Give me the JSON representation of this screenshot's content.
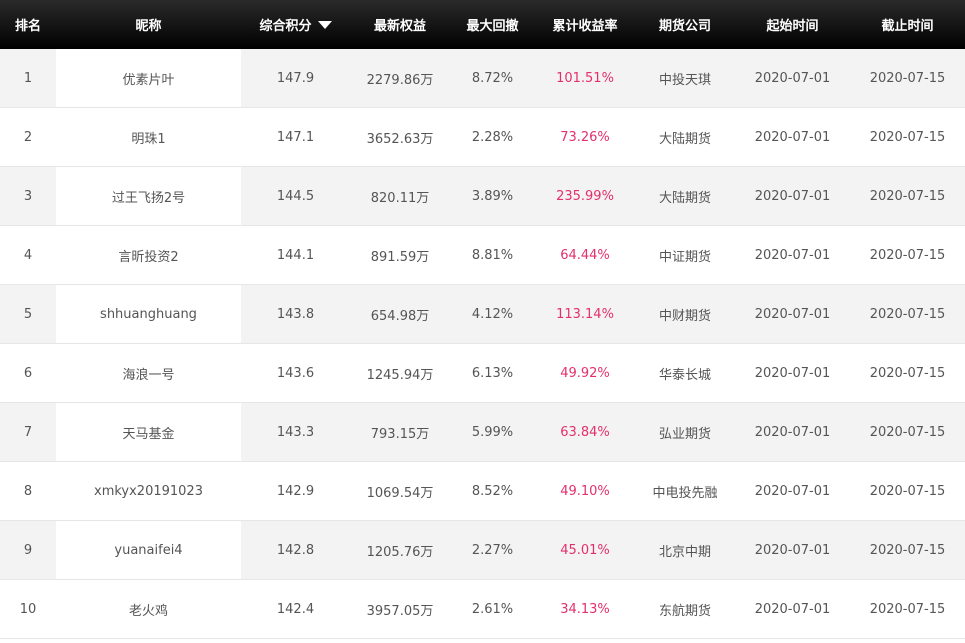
{
  "table": {
    "headers": {
      "rank": "排名",
      "nickname": "昵称",
      "score": "综合积分",
      "equity": "最新权益",
      "drawdown": "最大回撤",
      "return_rate": "累计收益率",
      "company": "期货公司",
      "start": "起始时间",
      "end": "截止时间"
    },
    "sort_icon": "sort-desc-triangle-icon",
    "accent_color": "#e3306c",
    "rows": [
      {
        "rank": "1",
        "nickname": "优素片叶",
        "score": "147.9",
        "equity": "2279.86万",
        "drawdown": "8.72%",
        "return_rate": "101.51%",
        "company": "中投天琪",
        "start": "2020-07-01",
        "end": "2020-07-15"
      },
      {
        "rank": "2",
        "nickname": "明珠1",
        "score": "147.1",
        "equity": "3652.63万",
        "drawdown": "2.28%",
        "return_rate": "73.26%",
        "company": "大陆期货",
        "start": "2020-07-01",
        "end": "2020-07-15"
      },
      {
        "rank": "3",
        "nickname": "过王飞扬2号",
        "score": "144.5",
        "equity": "820.11万",
        "drawdown": "3.89%",
        "return_rate": "235.99%",
        "company": "大陆期货",
        "start": "2020-07-01",
        "end": "2020-07-15"
      },
      {
        "rank": "4",
        "nickname": "言昕投资2",
        "score": "144.1",
        "equity": "891.59万",
        "drawdown": "8.81%",
        "return_rate": "64.44%",
        "company": "中证期货",
        "start": "2020-07-01",
        "end": "2020-07-15"
      },
      {
        "rank": "5",
        "nickname": "shhuanghuang",
        "score": "143.8",
        "equity": "654.98万",
        "drawdown": "4.12%",
        "return_rate": "113.14%",
        "company": "中财期货",
        "start": "2020-07-01",
        "end": "2020-07-15"
      },
      {
        "rank": "6",
        "nickname": "海浪一号",
        "score": "143.6",
        "equity": "1245.94万",
        "drawdown": "6.13%",
        "return_rate": "49.92%",
        "company": "华泰长城",
        "start": "2020-07-01",
        "end": "2020-07-15"
      },
      {
        "rank": "7",
        "nickname": "天马基金",
        "score": "143.3",
        "equity": "793.15万",
        "drawdown": "5.99%",
        "return_rate": "63.84%",
        "company": "弘业期货",
        "start": "2020-07-01",
        "end": "2020-07-15"
      },
      {
        "rank": "8",
        "nickname": "xmkyx20191023",
        "score": "142.9",
        "equity": "1069.54万",
        "drawdown": "8.52%",
        "return_rate": "49.10%",
        "company": "中电投先融",
        "start": "2020-07-01",
        "end": "2020-07-15"
      },
      {
        "rank": "9",
        "nickname": "yuanaifei4",
        "score": "142.8",
        "equity": "1205.76万",
        "drawdown": "2.27%",
        "return_rate": "45.01%",
        "company": "北京中期",
        "start": "2020-07-01",
        "end": "2020-07-15"
      },
      {
        "rank": "10",
        "nickname": "老火鸡",
        "score": "142.4",
        "equity": "3957.05万",
        "drawdown": "2.61%",
        "return_rate": "34.13%",
        "company": "东航期货",
        "start": "2020-07-01",
        "end": "2020-07-15"
      }
    ]
  }
}
